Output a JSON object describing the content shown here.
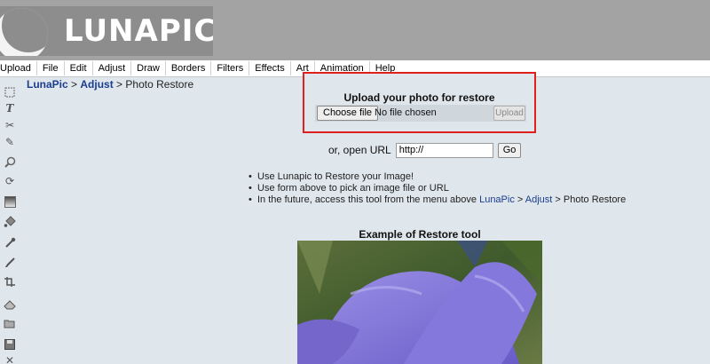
{
  "header": {
    "logo_text": "LUNAPIC",
    "brand_color": "#8d8d8d"
  },
  "menu": [
    "Upload",
    "File",
    "Edit",
    "Adjust",
    "Draw",
    "Borders",
    "Filters",
    "Effects",
    "Art",
    "Animation",
    "Help"
  ],
  "toolbar": {
    "icons": [
      "select-icon",
      "text-icon",
      "scissors-icon",
      "pencil-icon",
      "magnifier-icon",
      "rotate-icon",
      "gradient-icon",
      "paint-bucket-icon",
      "eyedropper-icon",
      "brush-icon",
      "crop-icon",
      "eraser-icon",
      "open-folder-icon",
      "save-icon",
      "close-icon"
    ]
  },
  "breadcrumb": {
    "root": "LunaPic",
    "sep1": " > ",
    "section": "Adjust",
    "sep2": " > ",
    "current": "Photo Restore"
  },
  "upload": {
    "title": "Upload your photo for restore",
    "choose_label": "Choose file",
    "file_status": "No file chosen",
    "upload_label": "Upload",
    "highlight_color": "#e02020"
  },
  "url": {
    "label": "or, open URL",
    "value": "http://",
    "go_label": "Go"
  },
  "bullets": {
    "b1": "Use Lunapic to Restore your Image!",
    "b2": "Use form above to pick an image file or URL",
    "b3_prefix": "In the future, access this tool from the menu above ",
    "b3_link1": "LunaPic",
    "b3_sep1": " > ",
    "b3_link2": "Adjust",
    "b3_suffix": " > Photo Restore"
  },
  "example": {
    "title": "Example of Restore tool"
  }
}
